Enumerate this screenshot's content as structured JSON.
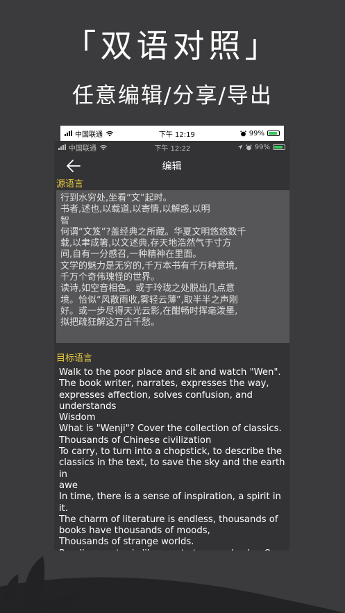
{
  "promo": {
    "title": "「双语对照」",
    "subtitle": "任意编辑/分享/导出"
  },
  "outer_status": {
    "carrier": "中国联通",
    "time": "下午 12:19",
    "battery": "99%"
  },
  "inner_status": {
    "carrier": "中国联通",
    "time": "下午 12:22",
    "battery": "99%"
  },
  "navbar": {
    "title": "编辑"
  },
  "source": {
    "label": "源语言",
    "text": "行到水穷处,坐看“文”起时。\n书者,述也,以载道,以寄情,以解惑,以明\n智\n何谓“文笈”?盖经典之所藏。华夏文明悠悠数千\n载,以聿成箸,以文述典,存天地浩然气于寸方\n间,自有一分感召,一种精神在里面。\n文学的魅力是无穷的,千万本书有千万种意境,\n千万个奇伟瑰怪的世界。\n读诗,如空音相色。或于玲珑之处脱出几点意\n境。恰似“风散雨收,雾轻云薄”,取半半之声刚\n好。或一步尽得天光云影,在酣畅时挥毫泼墨,\n拟把疏狂解这万古千愁。"
  },
  "target": {
    "label": "目标语言",
    "text": "Walk to the poor place and sit and watch \"Wen\".\nThe book writer, narrates, expresses the way,\nexpresses affection, solves confusion, and\nunderstands\nWisdom\nWhat is \"Wenji\"? Cover the collection of classics.\nThousands of Chinese civilization\nTo carry, to turn into a chopstick, to describe the\nclassics in the text, to save the sky and the earth in\nawe\nIn time, there is a sense of inspiration, a spirit in it.\nThe charm of literature is endless, thousands of\nbooks have thousands of moods,\nThousands of strange worlds.\nReading poetry is like empty tone and color. Or to\nexpress a few ideas in Linglong\nterritory. Just like \"the wind is scattered and the rain"
  },
  "icons": {
    "back": "arrow-left-icon",
    "wifi": "wifi-icon",
    "signal": "signal-icon",
    "battery": "battery-icon",
    "alarm": "alarm-icon",
    "location": "location-icon"
  },
  "colors": {
    "background": "#3b3b3d",
    "phone_background": "#333335",
    "source_box": "#565658",
    "label_accent": "#e6c93e",
    "decor": "#232325"
  }
}
